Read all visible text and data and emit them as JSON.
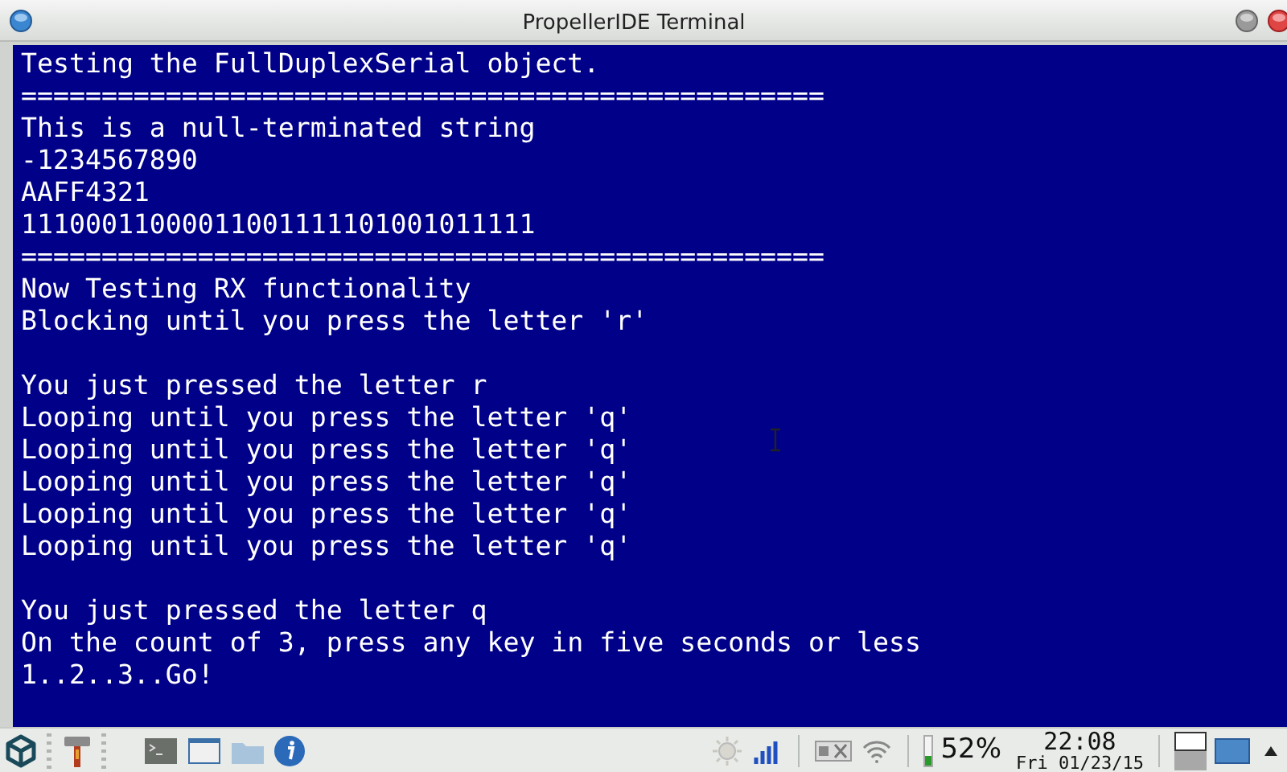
{
  "window": {
    "title": "PropellerIDE Terminal"
  },
  "terminal": {
    "lines": [
      {
        "kind": "text",
        "text": "Testing the FullDuplexSerial object."
      },
      {
        "kind": "text",
        "text": "=================================================="
      },
      {
        "kind": "text",
        "text": "This is a null-terminated string"
      },
      {
        "kind": "text",
        "text": "-1234567890"
      },
      {
        "kind": "text",
        "text": "AAFF4321"
      },
      {
        "kind": "text",
        "text": "11100011000011001111101001011111"
      },
      {
        "kind": "text",
        "text": "=================================================="
      },
      {
        "kind": "text",
        "text": "Now Testing RX functionality"
      },
      {
        "kind": "text",
        "text": "Blocking until you press the letter 'r'"
      },
      {
        "kind": "blank"
      },
      {
        "kind": "text",
        "text": "You just pressed the letter r"
      },
      {
        "kind": "text",
        "text": "Looping until you press the letter 'q'"
      },
      {
        "kind": "text",
        "text": "Looping until you press the letter 'q'"
      },
      {
        "kind": "text",
        "text": "Looping until you press the letter 'q'"
      },
      {
        "kind": "text",
        "text": "Looping until you press the letter 'q'"
      },
      {
        "kind": "text",
        "text": "Looping until you press the letter 'q'"
      },
      {
        "kind": "blank"
      },
      {
        "kind": "text",
        "text": "You just pressed the letter q"
      },
      {
        "kind": "text",
        "text": "On the count of 3, press any key in five seconds or less"
      },
      {
        "kind": "text",
        "text": "1..2..3..Go!"
      }
    ]
  },
  "taskbar": {
    "battery": "52%",
    "time": "22:08",
    "date": "Fri 01/23/15"
  }
}
